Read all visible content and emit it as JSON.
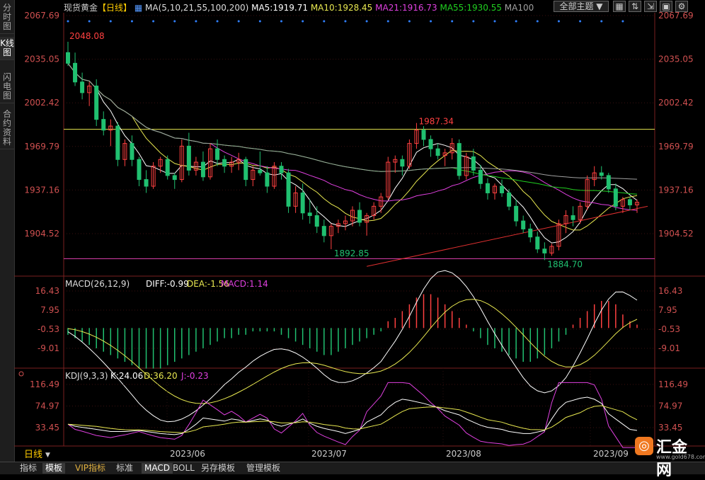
{
  "sidebar": {
    "tabs": [
      {
        "label": "分时图",
        "active": false
      },
      {
        "label": "K线图",
        "active": true
      },
      {
        "label": "闪电图",
        "active": false
      },
      {
        "label": "合约资料",
        "active": false
      }
    ]
  },
  "header": {
    "symbol": "现货黄金",
    "period": "【日线】",
    "ma_label": "MA(5,10,21,55,100,200)",
    "ma5": "MA5:1919.71",
    "ma10": "MA10:1928.45",
    "ma21": "MA21:1916.73",
    "ma55": "MA55:1930.55",
    "ma100": "MA100",
    "theme_button": "全部主题"
  },
  "main_axis": {
    "ticks": [
      "2067.69",
      "2035.05",
      "2002.42",
      "1969.79",
      "1937.16",
      "1904.52"
    ]
  },
  "annotations": {
    "high": "2048.08",
    "mid_high": "1987.34",
    "low1": "1892.85",
    "low2": "1884.70"
  },
  "macd": {
    "label": "MACD(26,12,9)",
    "diff": "DIFF:-0.99",
    "dea": "DEA:-1.56",
    "macd": "MACD:1.14",
    "ticks": [
      "16.43",
      "7.95",
      "-0.53",
      "-9.01"
    ]
  },
  "kdj": {
    "label": "KDJ(9,3,3)",
    "k": "K:24.06",
    "d": "D:36.20",
    "j": "J:-0.23",
    "ticks": [
      "116.49",
      "74.97",
      "33.45"
    ]
  },
  "x_axis": {
    "labels": [
      "2023/06",
      "2023/07",
      "2023/08",
      "2023/09"
    ]
  },
  "period_select": "日线",
  "bottom_tabs": [
    {
      "label": "指标",
      "active": false,
      "vip": false
    },
    {
      "label": "模板",
      "active": true,
      "vip": false
    },
    {
      "label": "VIP指标",
      "active": false,
      "vip": true
    },
    {
      "label": "标准",
      "active": false,
      "vip": false
    },
    {
      "label": "MACD",
      "active": true,
      "vip": false
    },
    {
      "label": "BOLL",
      "active": false,
      "vip": false
    },
    {
      "label": "另存模板",
      "active": false,
      "vip": false
    },
    {
      "label": "管理模板",
      "active": false,
      "vip": false
    }
  ],
  "logo": {
    "brand": "汇金网",
    "site": "www.gold678.com"
  },
  "colors": {
    "up": "#ff4040",
    "down": "#20c070",
    "ma5": "#ffffff",
    "ma10": "#e8e850",
    "ma21": "#e040e0",
    "ma55": "#20d020",
    "ma100": "#a0a0a0",
    "trend": "#e03030",
    "hline_top": "#e8e850",
    "hline_low": "#e040b0"
  },
  "chart_data": {
    "type": "candlestick",
    "title": "现货黄金",
    "ylim": [
      1880,
      2070
    ],
    "ohlc": [
      [
        2040,
        2048.08,
        2030,
        2032
      ],
      [
        2032,
        2040,
        2015,
        2018
      ],
      [
        2018,
        2025,
        2005,
        2010
      ],
      [
        2010,
        2018,
        2000,
        2015
      ],
      [
        2015,
        2020,
        1985,
        1990
      ],
      [
        1990,
        1996,
        1978,
        1982
      ],
      [
        1982,
        1990,
        1970,
        1985
      ],
      [
        1985,
        1988,
        1955,
        1960
      ],
      [
        1960,
        1975,
        1955,
        1972
      ],
      [
        1972,
        1978,
        1955,
        1960
      ],
      [
        1960,
        1962,
        1940,
        1945
      ],
      [
        1945,
        1952,
        1935,
        1940
      ],
      [
        1940,
        1958,
        1938,
        1955
      ],
      [
        1955,
        1962,
        1950,
        1960
      ],
      [
        1960,
        1963,
        1945,
        1948
      ],
      [
        1948,
        1950,
        1938,
        1945
      ],
      [
        1945,
        1975,
        1943,
        1970
      ],
      [
        1970,
        1980,
        1948,
        1952
      ],
      [
        1952,
        1962,
        1948,
        1958
      ],
      [
        1958,
        1966,
        1944,
        1947
      ],
      [
        1947,
        1972,
        1945,
        1968
      ],
      [
        1968,
        1975,
        1955,
        1960
      ],
      [
        1960,
        1963,
        1950,
        1955
      ],
      [
        1955,
        1962,
        1950,
        1958
      ],
      [
        1958,
        1965,
        1952,
        1960
      ],
      [
        1960,
        1962,
        1940,
        1945
      ],
      [
        1945,
        1955,
        1940,
        1952
      ],
      [
        1952,
        1966,
        1948,
        1950
      ],
      [
        1950,
        1955,
        1935,
        1940
      ],
      [
        1940,
        1958,
        1938,
        1955
      ],
      [
        1955,
        1958,
        1945,
        1950
      ],
      [
        1950,
        1953,
        1920,
        1925
      ],
      [
        1925,
        1940,
        1920,
        1935
      ],
      [
        1935,
        1942,
        1915,
        1920
      ],
      [
        1920,
        1930,
        1912,
        1918
      ],
      [
        1918,
        1925,
        1905,
        1910
      ],
      [
        1910,
        1915,
        1898,
        1903
      ],
      [
        1903,
        1912,
        1892.85,
        1910
      ],
      [
        1910,
        1915,
        1905,
        1912
      ],
      [
        1912,
        1918,
        1907,
        1914
      ],
      [
        1914,
        1925,
        1910,
        1922
      ],
      [
        1922,
        1928,
        1910,
        1913
      ],
      [
        1913,
        1920,
        1903,
        1918
      ],
      [
        1918,
        1928,
        1915,
        1925
      ],
      [
        1925,
        1935,
        1920,
        1932
      ],
      [
        1932,
        1962,
        1930,
        1958
      ],
      [
        1958,
        1963,
        1950,
        1960
      ],
      [
        1960,
        1963,
        1948,
        1955
      ],
      [
        1955,
        1975,
        1953,
        1972
      ],
      [
        1972,
        1987.34,
        1968,
        1982
      ],
      [
        1982,
        1985,
        1970,
        1975
      ],
      [
        1975,
        1978,
        1962,
        1968
      ],
      [
        1968,
        1972,
        1960,
        1963
      ],
      [
        1963,
        1968,
        1955,
        1965
      ],
      [
        1965,
        1976,
        1960,
        1972
      ],
      [
        1972,
        1975,
        1945,
        1948
      ],
      [
        1948,
        1965,
        1945,
        1962
      ],
      [
        1962,
        1968,
        1948,
        1952
      ],
      [
        1952,
        1956,
        1938,
        1942
      ],
      [
        1942,
        1946,
        1930,
        1935
      ],
      [
        1935,
        1942,
        1930,
        1940
      ],
      [
        1940,
        1945,
        1932,
        1935
      ],
      [
        1935,
        1938,
        1922,
        1925
      ],
      [
        1925,
        1930,
        1910,
        1914
      ],
      [
        1914,
        1918,
        1905,
        1908
      ],
      [
        1908,
        1912,
        1898,
        1902
      ],
      [
        1902,
        1906,
        1890,
        1893
      ],
      [
        1893,
        1898,
        1884.7,
        1890
      ],
      [
        1890,
        1897,
        1888,
        1895
      ],
      [
        1895,
        1915,
        1892,
        1912
      ],
      [
        1912,
        1922,
        1905,
        1918
      ],
      [
        1918,
        1925,
        1910,
        1915
      ],
      [
        1915,
        1928,
        1912,
        1925
      ],
      [
        1925,
        1948,
        1922,
        1945
      ],
      [
        1945,
        1955,
        1940,
        1950
      ],
      [
        1950,
        1955,
        1945,
        1948
      ],
      [
        1948,
        1950,
        1935,
        1938
      ],
      [
        1938,
        1942,
        1922,
        1925
      ],
      [
        1925,
        1932,
        1920,
        1930
      ],
      [
        1930,
        1932,
        1922,
        1926
      ],
      [
        1926,
        1930,
        1920,
        1928
      ]
    ],
    "macd_hist": [
      -2,
      -3,
      -4,
      -5,
      -6,
      -7,
      -8,
      -9,
      -10,
      -11,
      -12,
      -12,
      -12,
      -12,
      -11,
      -10,
      -9,
      -8,
      -7,
      -6,
      -5,
      -4,
      -3,
      -3,
      -2,
      -2,
      -1,
      -1,
      -1,
      -1,
      -2,
      -3,
      -4,
      -5,
      -6,
      -7,
      -8,
      -8,
      -7,
      -6,
      -5,
      -4,
      -3,
      -2,
      -1,
      2,
      3,
      5,
      7,
      9,
      10,
      10,
      9,
      7,
      5,
      3,
      1,
      -1,
      -3,
      -5,
      -6,
      -7,
      -8,
      -9,
      -10,
      -10,
      -9,
      -8,
      -6,
      -4,
      -2,
      1,
      3,
      5,
      7,
      8,
      8,
      7,
      4,
      2,
      1
    ],
    "kdj_k": [
      40,
      36,
      34,
      30,
      28,
      26,
      26,
      26,
      28,
      26,
      24,
      22,
      20,
      22,
      30,
      40,
      52,
      48,
      46,
      50,
      48,
      44,
      50,
      48,
      40,
      36,
      44,
      50,
      42,
      36,
      32,
      26,
      22,
      26,
      30,
      44,
      58,
      72,
      82,
      88,
      86,
      80,
      76,
      72,
      66,
      58,
      50,
      44,
      38,
      34,
      30,
      26,
      24,
      22,
      22,
      28,
      50,
      70,
      82,
      90,
      92,
      88,
      80,
      60,
      40,
      30,
      28
    ],
    "x_labels": [
      "2023/06",
      "2023/07",
      "2023/08",
      "2023/09"
    ]
  }
}
